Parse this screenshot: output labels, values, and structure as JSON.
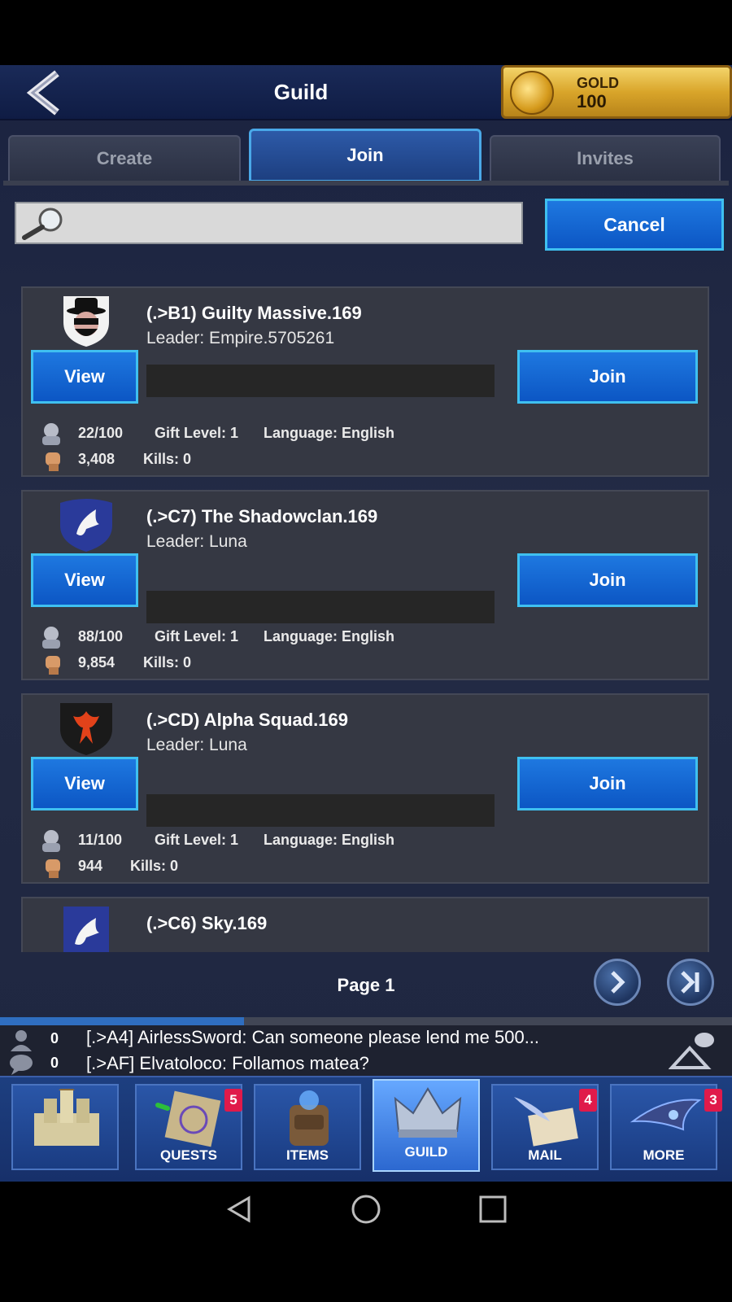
{
  "header": {
    "title": "Guild",
    "gold_label": "GOLD",
    "gold_value": "100"
  },
  "tabs": [
    {
      "label": "Create"
    },
    {
      "label": "Join"
    },
    {
      "label": "Invites"
    }
  ],
  "search": {
    "placeholder": "",
    "cancel_label": "Cancel"
  },
  "buttons": {
    "view": "View",
    "join": "Join"
  },
  "guilds": [
    {
      "name": "(.>B1) Guilty Massive.169",
      "leader": "Leader: Empire.5705261",
      "members": "22/100",
      "gift_level": "Gift Level: 1",
      "language": "Language: English",
      "power": "3,408",
      "kills": "Kills: 0",
      "emblem": "masked-bandit-icon"
    },
    {
      "name": "(.>C7) The Shadowclan.169",
      "leader": "Leader: Luna",
      "members": "88/100",
      "gift_level": "Gift Level: 1",
      "language": "Language: English",
      "power": "9,854",
      "kills": "Kills: 0",
      "emblem": "dove-shield-icon"
    },
    {
      "name": "(.>CD) Alpha Squad.169",
      "leader": "Leader: Luna",
      "members": "11/100",
      "gift_level": "Gift Level: 1",
      "language": "Language: English",
      "power": "944",
      "kills": "Kills: 0",
      "emblem": "phoenix-shield-icon"
    },
    {
      "name": "(.>C6) Sky.169",
      "emblem": "dove-banner-icon"
    }
  ],
  "pager": {
    "label": "Page 1"
  },
  "chat": [
    {
      "count": "0",
      "message": "[.>A4] AirlessSword: Can someone please lend me 500..."
    },
    {
      "count": "0",
      "message": "[.>AF] Elvatoloco: Follamos matea?"
    }
  ],
  "nav": [
    {
      "label": "",
      "icon": "castle-icon"
    },
    {
      "label": "QUESTS",
      "badge": "5",
      "icon": "scroll-icon"
    },
    {
      "label": "ITEMS",
      "icon": "backpack-icon"
    },
    {
      "label": "GUILD",
      "icon": "crown-icon"
    },
    {
      "label": "MAIL",
      "badge": "4",
      "icon": "envelope-icon"
    },
    {
      "label": "MORE",
      "badge": "3",
      "icon": "more-icon"
    }
  ],
  "colors": {
    "accent": "#0c56c4",
    "accent_border": "#3fc0f0",
    "badge": "#e01a4a",
    "gold": "#d9a52a"
  }
}
